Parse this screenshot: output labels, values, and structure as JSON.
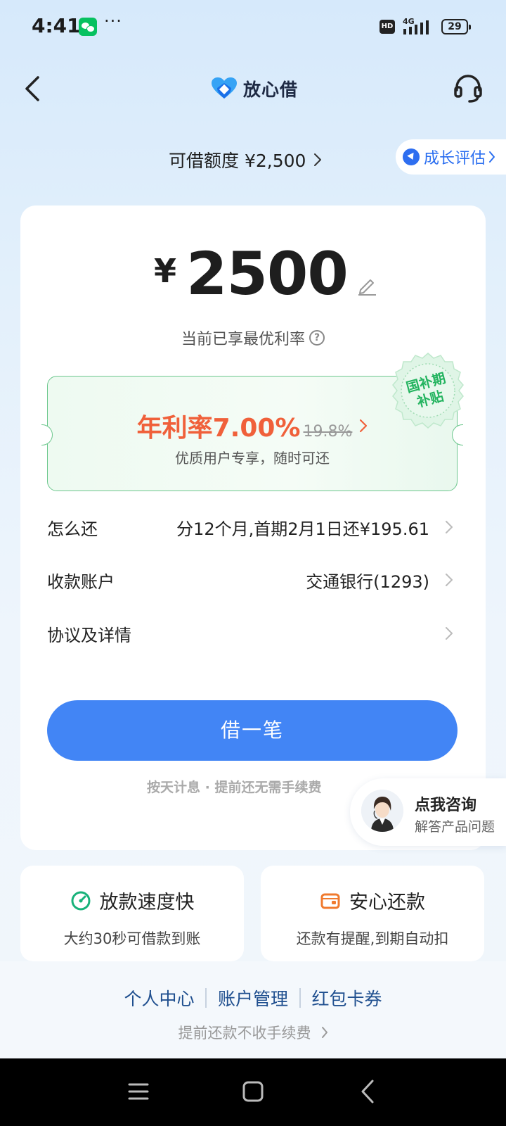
{
  "status_bar": {
    "time": "4:41",
    "dots": "···",
    "hd": "HD",
    "network": "4G",
    "battery": "29",
    "icons": [
      "wechat-icon",
      "signal-icon",
      "battery-icon"
    ]
  },
  "header": {
    "app_name": "放心借",
    "icons": [
      "back-arrow-icon",
      "brand-heart-logo",
      "customer-service-headset-icon"
    ]
  },
  "limit": {
    "text": "可借额度 ¥2,500",
    "growth_label": "成长评估"
  },
  "loan": {
    "currency": "¥",
    "amount": "2500",
    "rate_note": "当前已享最优利率",
    "help": "?"
  },
  "rate_box": {
    "rate_label": "年利率7.00%",
    "old_rate": "19.8%",
    "sub": "优质用户专享，随时可还",
    "seal_line1": "国补期",
    "seal_line2": "补贴"
  },
  "details": [
    {
      "label": "怎么还",
      "value": "分12个月,首期2月1日还¥195.61"
    },
    {
      "label": "收款账户",
      "value": "交通银行(1293)"
    },
    {
      "label": "协议及详情",
      "value": ""
    }
  ],
  "borrow_button": "借一笔",
  "interest_note": "按天计息 · 提前还无需手续费",
  "consult": {
    "title": "点我咨询",
    "sub": "解答产品问题"
  },
  "features": [
    {
      "title": "放款速度快",
      "desc": "大约30秒可借款到账",
      "icon": "speed-clock-icon"
    },
    {
      "title": "安心还款",
      "desc": "还款有提醒,到期自动扣",
      "icon": "wallet-icon"
    }
  ],
  "bottom_links": [
    "个人中心",
    "账户管理",
    "红包卡券"
  ],
  "prepay_note": "提前还款不收手续费",
  "colors": {
    "primary": "#4285f5",
    "rate_orange": "#f0603a",
    "green_border": "#6cc78d",
    "link_blue": "#1f4f8f"
  }
}
